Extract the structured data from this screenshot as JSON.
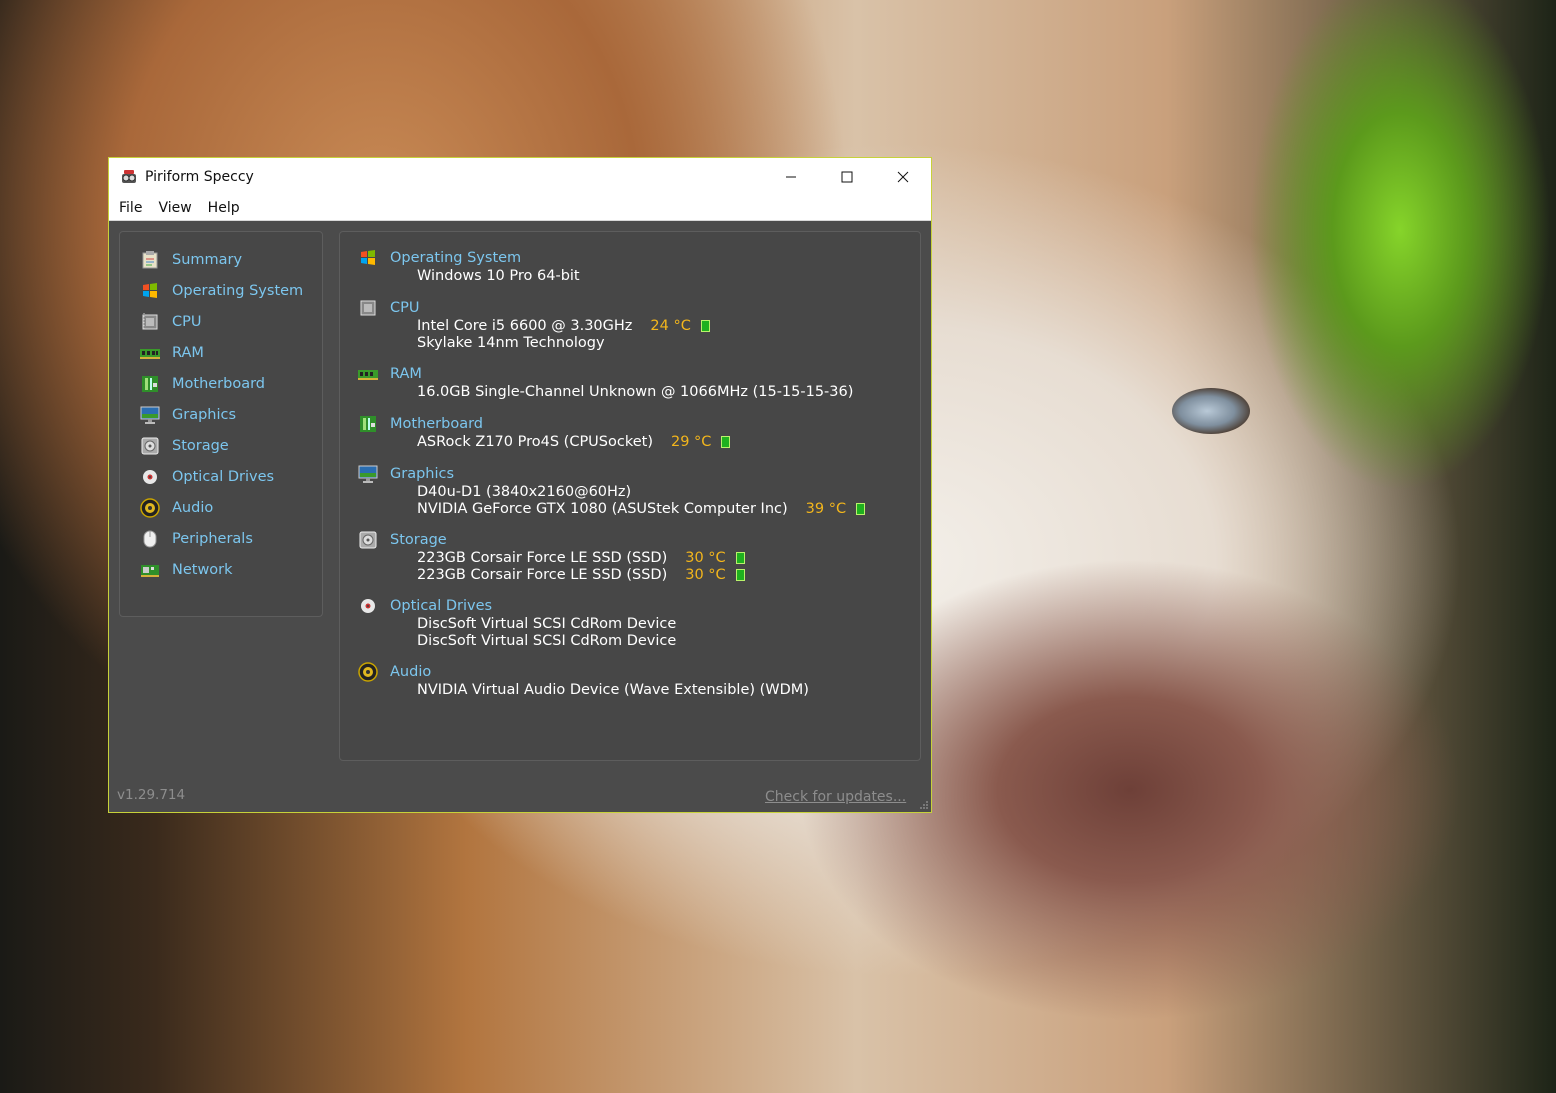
{
  "window": {
    "title": "Piriform Speccy",
    "app_icon": "speccy-icon",
    "controls": [
      "minimize-icon",
      "maximize-icon",
      "close-icon"
    ]
  },
  "menu": [
    "File",
    "View",
    "Help"
  ],
  "sidebar": {
    "items": [
      {
        "label": "Summary",
        "icon": "summary-icon"
      },
      {
        "label": "Operating System",
        "icon": "windows-logo-icon"
      },
      {
        "label": "CPU",
        "icon": "cpu-chip-icon"
      },
      {
        "label": "RAM",
        "icon": "ram-icon"
      },
      {
        "label": "Motherboard",
        "icon": "motherboard-icon"
      },
      {
        "label": "Graphics",
        "icon": "monitor-icon"
      },
      {
        "label": "Storage",
        "icon": "hard-drive-icon"
      },
      {
        "label": "Optical Drives",
        "icon": "disc-icon"
      },
      {
        "label": "Audio",
        "icon": "speaker-icon"
      },
      {
        "label": "Peripherals",
        "icon": "mouse-icon"
      },
      {
        "label": "Network",
        "icon": "network-card-icon"
      }
    ]
  },
  "summary": {
    "os": {
      "title": "Operating System",
      "lines": [
        "Windows 10 Pro 64-bit"
      ]
    },
    "cpu": {
      "title": "CPU",
      "lines": [
        "Intel Core i5 6600 @ 3.30GHz",
        "Skylake 14nm Technology"
      ],
      "temp": "24 °C"
    },
    "ram": {
      "title": "RAM",
      "lines": [
        "16.0GB Single-Channel Unknown @ 1066MHz (15-15-15-36)"
      ]
    },
    "motherboard": {
      "title": "Motherboard",
      "lines": [
        "ASRock Z170 Pro4S (CPUSocket)"
      ],
      "temp": "29 °C"
    },
    "graphics": {
      "title": "Graphics",
      "lines": [
        "D40u-D1 (3840x2160@60Hz)",
        "NVIDIA GeForce GTX 1080 (ASUStek Computer Inc)"
      ],
      "temp": "39 °C"
    },
    "storage": {
      "title": "Storage",
      "lines": [
        "223GB Corsair Force LE SSD (SSD)",
        "223GB Corsair Force LE SSD (SSD)"
      ],
      "temps": [
        "30 °C",
        "30 °C"
      ]
    },
    "optical": {
      "title": "Optical Drives",
      "lines": [
        "DiscSoft Virtual SCSI CdRom Device",
        "DiscSoft Virtual SCSI CdRom Device"
      ]
    },
    "audio": {
      "title": "Audio",
      "lines": [
        "NVIDIA Virtual Audio Device (Wave Extensible) (WDM)"
      ]
    }
  },
  "status": {
    "version": "v1.29.714",
    "update_link": "Check for updates..."
  },
  "colors": {
    "heading": "#7cc6ee",
    "text": "#ffffff",
    "temperature": "#f3b61c",
    "panel": "#4b4b4b",
    "window_border": "#c7d23a"
  }
}
